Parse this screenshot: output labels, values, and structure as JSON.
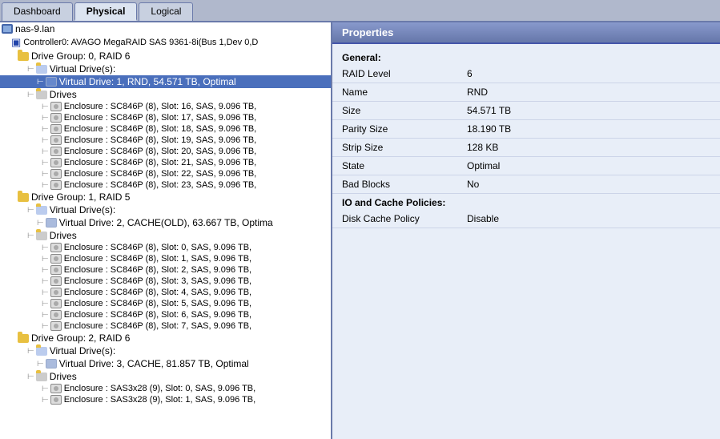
{
  "tabs": [
    {
      "label": "Dashboard",
      "id": "dashboard"
    },
    {
      "label": "Physical",
      "id": "physical",
      "active": true
    },
    {
      "label": "Logical",
      "id": "logical"
    }
  ],
  "tree": {
    "root": "nas-9.lan",
    "controller": "Controller0: AVAGO MegaRAID SAS 9361-8i(Bus 1,Dev 0,D",
    "drive_groups": [
      {
        "label": "Drive Group: 0, RAID  6",
        "virtual_drives_header": "Virtual Drive(s):",
        "virtual_drives": [
          {
            "label": "Virtual Drive: 1, RND, 54.571 TB, Optimal",
            "selected": true
          }
        ],
        "drives_header": "Drives",
        "enclosures": [
          "Enclosure : SC846P (8), Slot: 16, SAS, 9.096 TB,",
          "Enclosure : SC846P (8), Slot: 17, SAS, 9.096 TB,",
          "Enclosure : SC846P (8), Slot: 18, SAS, 9.096 TB,",
          "Enclosure : SC846P (8), Slot: 19, SAS, 9.096 TB,",
          "Enclosure : SC846P (8), Slot: 20, SAS, 9.096 TB,",
          "Enclosure : SC846P (8), Slot: 21, SAS, 9.096 TB,",
          "Enclosure : SC846P (8), Slot: 22, SAS, 9.096 TB,",
          "Enclosure : SC846P (8), Slot: 23, SAS, 9.096 TB,"
        ]
      },
      {
        "label": "Drive Group: 1, RAID  5",
        "virtual_drives_header": "Virtual Drive(s):",
        "virtual_drives": [
          {
            "label": "Virtual Drive: 2, CACHE(OLD), 63.667 TB, Optima",
            "selected": false
          }
        ],
        "drives_header": "Drives",
        "enclosures": [
          "Enclosure : SC846P (8), Slot: 0, SAS, 9.096 TB,",
          "Enclosure : SC846P (8), Slot: 1, SAS, 9.096 TB,",
          "Enclosure : SC846P (8), Slot: 2, SAS, 9.096 TB,",
          "Enclosure : SC846P (8), Slot: 3, SAS, 9.096 TB,",
          "Enclosure : SC846P (8), Slot: 4, SAS, 9.096 TB,",
          "Enclosure : SC846P (8), Slot: 5, SAS, 9.096 TB,",
          "Enclosure : SC846P (8), Slot: 6, SAS, 9.096 TB,",
          "Enclosure : SC846P (8), Slot: 7, SAS, 9.096 TB,"
        ]
      },
      {
        "label": "Drive Group: 2, RAID  6",
        "virtual_drives_header": "Virtual Drive(s):",
        "virtual_drives": [
          {
            "label": "Virtual Drive: 3, CACHE, 81.857 TB, Optimal",
            "selected": false
          }
        ],
        "drives_header": "Drives",
        "enclosures": [
          "Enclosure : SAS3x28 (9), Slot: 0, SAS, 9.096 TB,",
          "Enclosure : SAS3x28 (9), Slot: 1, SAS, 9.096 TB,"
        ]
      }
    ]
  },
  "properties": {
    "panel_title": "Properties",
    "sections": [
      {
        "label": "General:",
        "rows": [
          {
            "key": "RAID Level",
            "value": "6"
          },
          {
            "key": "Name",
            "value": "RND"
          },
          {
            "key": "Size",
            "value": "54.571 TB"
          },
          {
            "key": "Parity Size",
            "value": "18.190 TB"
          },
          {
            "key": "Strip Size",
            "value": "128 KB"
          },
          {
            "key": "State",
            "value": "Optimal"
          },
          {
            "key": "Bad Blocks",
            "value": "No"
          }
        ]
      },
      {
        "label": "IO and Cache Policies:",
        "rows": [
          {
            "key": "Disk Cache Policy",
            "value": "Disable"
          }
        ]
      }
    ]
  }
}
